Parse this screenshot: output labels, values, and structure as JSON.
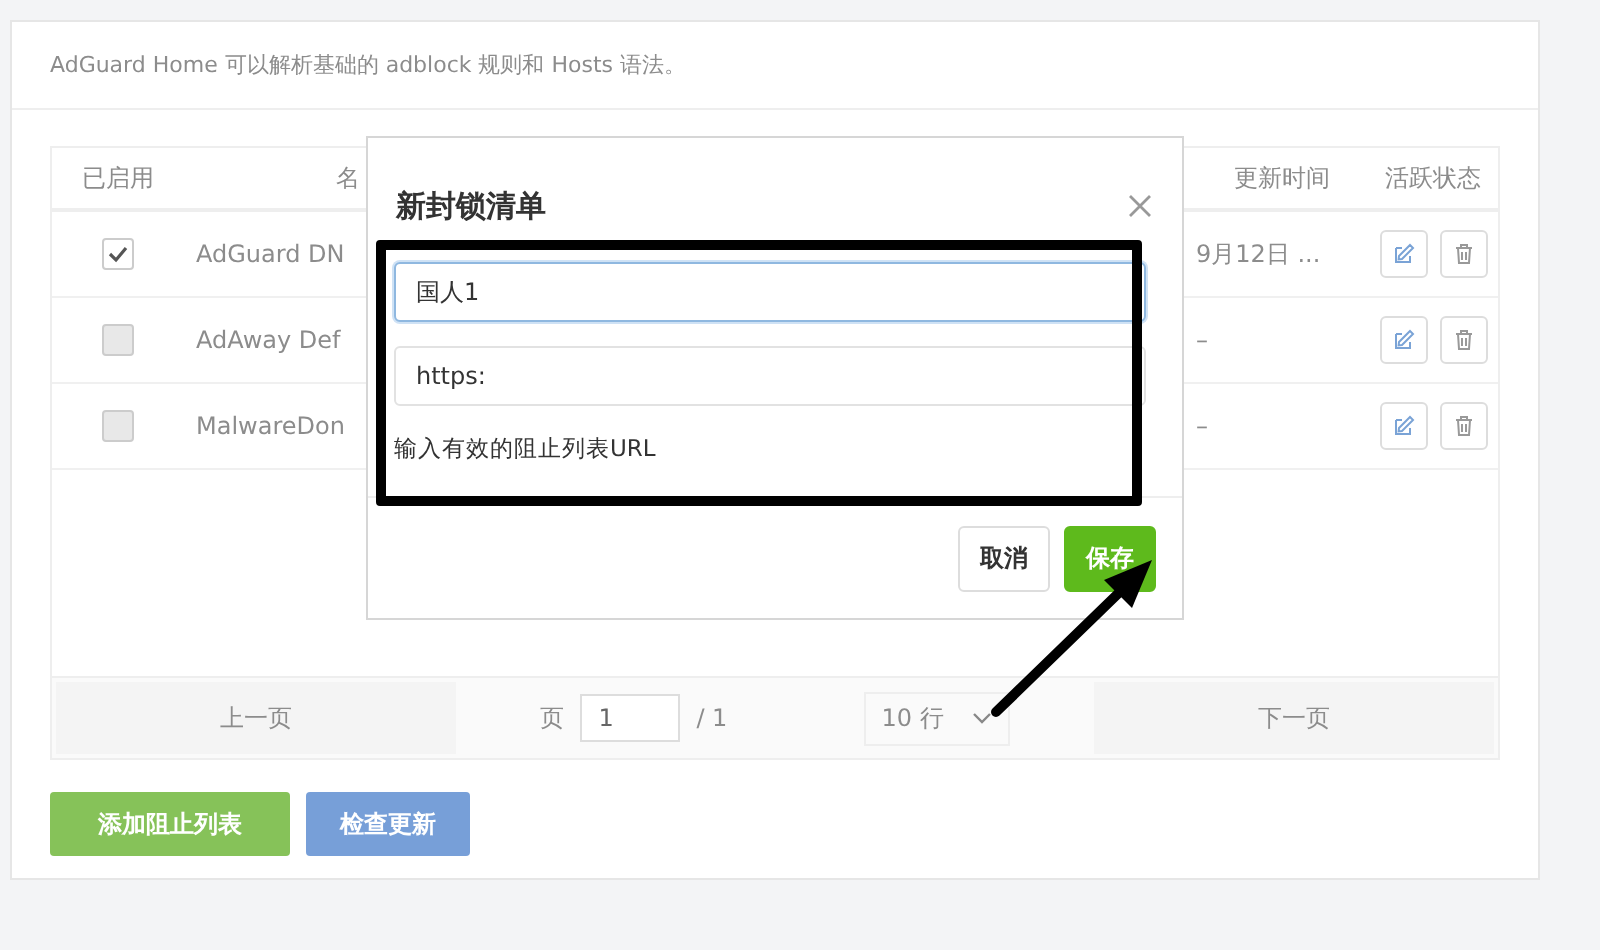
{
  "page": {
    "description": "AdGuard Home 可以解析基础的 adblock 规则和 Hosts 语法。",
    "table": {
      "columns": [
        "已启用",
        "名",
        "更新时间",
        "活跃状态"
      ],
      "rows": [
        {
          "enabled": true,
          "name": "AdGuard DN",
          "updated": "9月12日 ..."
        },
        {
          "enabled": false,
          "name": "AdAway Def",
          "updated": "–"
        },
        {
          "enabled": false,
          "name": "MalwareDon",
          "updated": "–"
        }
      ]
    },
    "pagination": {
      "prev": "上一页",
      "page_label": "页",
      "page": "1",
      "total": "/ 1",
      "rows_per_page": "10 行",
      "next": "下一页"
    },
    "buttons": [
      {
        "label": "添加阻止列表",
        "kind": "success"
      },
      {
        "label": "检查更新",
        "kind": "primary"
      }
    ]
  },
  "dialog": {
    "title": "新封锁清单",
    "fields": [
      {
        "value": "国人1",
        "focused": true
      },
      {
        "value": "https:",
        "focused": false
      }
    ],
    "hint": "输入有效的阻止列表URL",
    "buttons": [
      {
        "label": "取消",
        "kind": "default"
      },
      {
        "label": "保存",
        "kind": "primary"
      }
    ]
  }
}
